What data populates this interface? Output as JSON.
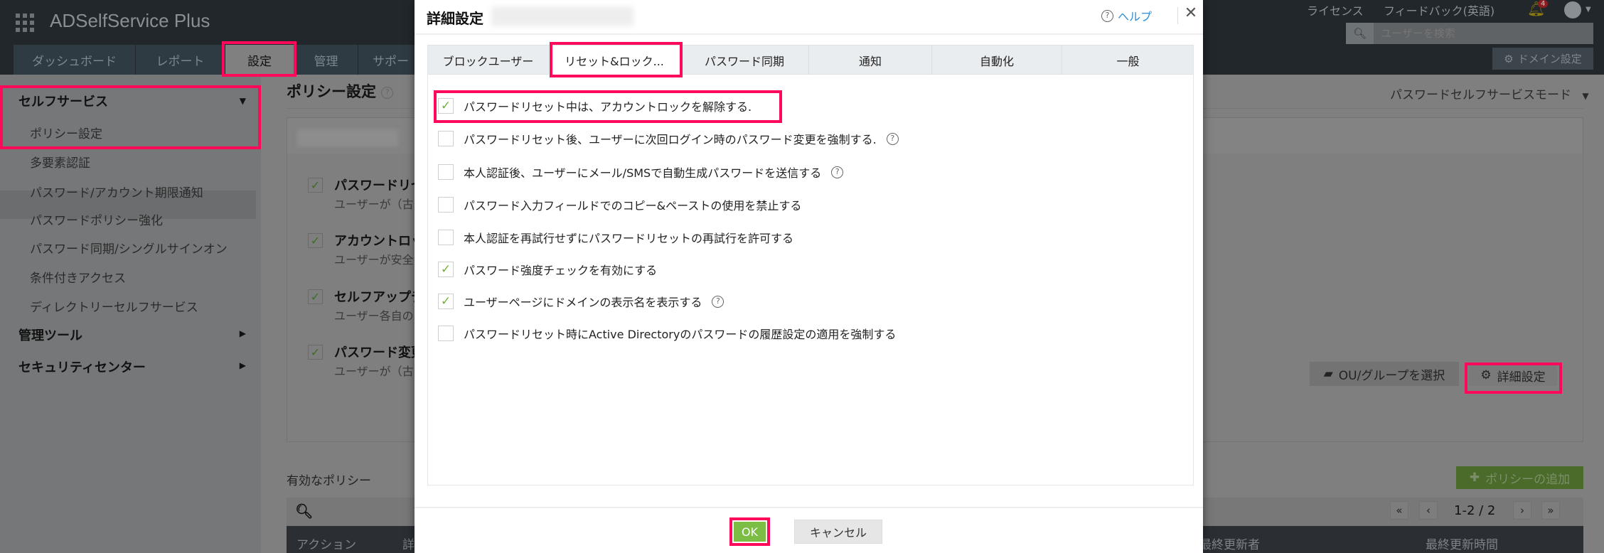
{
  "app": {
    "name": "ADSelfService Plus"
  },
  "topbar": {
    "license": "ライセンス",
    "feedback": "フィードバック(英語)",
    "notification_count": "4",
    "search_placeholder": "ユーザーを検索",
    "domain_settings": "ドメイン設定"
  },
  "nav": {
    "tabs": [
      {
        "label": "ダッシュボード"
      },
      {
        "label": "レポート"
      },
      {
        "label": "設定",
        "active": true
      },
      {
        "label": "管理"
      },
      {
        "label": "サポー"
      }
    ]
  },
  "sidebar": {
    "groups": [
      {
        "label": "セルフサービス",
        "expanded": true
      },
      {
        "label": "管理ツール"
      },
      {
        "label": "セキュリティセンター"
      }
    ],
    "items": [
      {
        "label": "ポリシー設定",
        "selected": true
      },
      {
        "label": "多要素認証"
      },
      {
        "label": "パスワード/アカウント期限通知"
      },
      {
        "label": "パスワードポリシー強化"
      },
      {
        "label": "パスワード同期/シングルサインオン"
      },
      {
        "label": "条件付きアクセス"
      },
      {
        "label": "ディレクトリーセルフサービス"
      }
    ]
  },
  "main": {
    "title": "ポリシー設定",
    "mode": "パスワードセルフサービスモード",
    "policies": [
      {
        "title": "パスワードリセ",
        "desc": "ユーザーが（古",
        "checked": true
      },
      {
        "title": "アカウントロッ",
        "desc": "ユーザーが安全",
        "checked": true
      },
      {
        "title": "セルフアップデ",
        "desc": "ユーザー各自の",
        "checked": true
      },
      {
        "title": "パスワード変更",
        "desc": "ユーザーが（古",
        "checked": true
      }
    ],
    "select_ou": "OU/グループを選択",
    "advanced": "詳細設定",
    "active_policies": "有効なポリシー",
    "add_policy": "ポリシーの追加",
    "pagination": "1-2 / 2",
    "columns": [
      "アクション",
      "詳",
      "最終更新者",
      "最終更新時間"
    ]
  },
  "dialog": {
    "title": "詳細設定",
    "help": "ヘルプ",
    "tabs": [
      {
        "label": "ブロックユーザー"
      },
      {
        "label": "リセット&ロック...",
        "active": true
      },
      {
        "label": "パスワード同期"
      },
      {
        "label": "通知"
      },
      {
        "label": "自動化"
      },
      {
        "label": "一般"
      }
    ],
    "options": [
      {
        "label": "パスワードリセット中は、アカウントロックを解除する.",
        "checked": true,
        "help": false
      },
      {
        "label": "パスワードリセット後、ユーザーに次回ログイン時のパスワード変更を強制する.",
        "checked": false,
        "help": true
      },
      {
        "label": "本人認証後、ユーザーにメール/SMSで自動生成パスワードを送信する",
        "checked": false,
        "help": true
      },
      {
        "label": "パスワード入力フィールドでのコピー&ペーストの使用を禁止する",
        "checked": false,
        "help": false
      },
      {
        "label": "本人認証を再試行せずにパスワードリセットの再試行を許可する",
        "checked": false,
        "help": false
      },
      {
        "label": "パスワード強度チェックを有効にする",
        "checked": true,
        "help": false
      },
      {
        "label": "ユーザーページにドメインの表示名を表示する",
        "checked": true,
        "help": true
      },
      {
        "label": "パスワードリセット時にActive Directoryのパスワードの履歴設定の適用を強制する",
        "checked": false,
        "help": false
      }
    ],
    "ok": "OK",
    "cancel": "キャンセル"
  },
  "colors": {
    "highlight": "#ff0a5a",
    "ok_green": "#7cbd45",
    "check_green": "#6fb33a",
    "link_blue": "#2f8fd6"
  }
}
